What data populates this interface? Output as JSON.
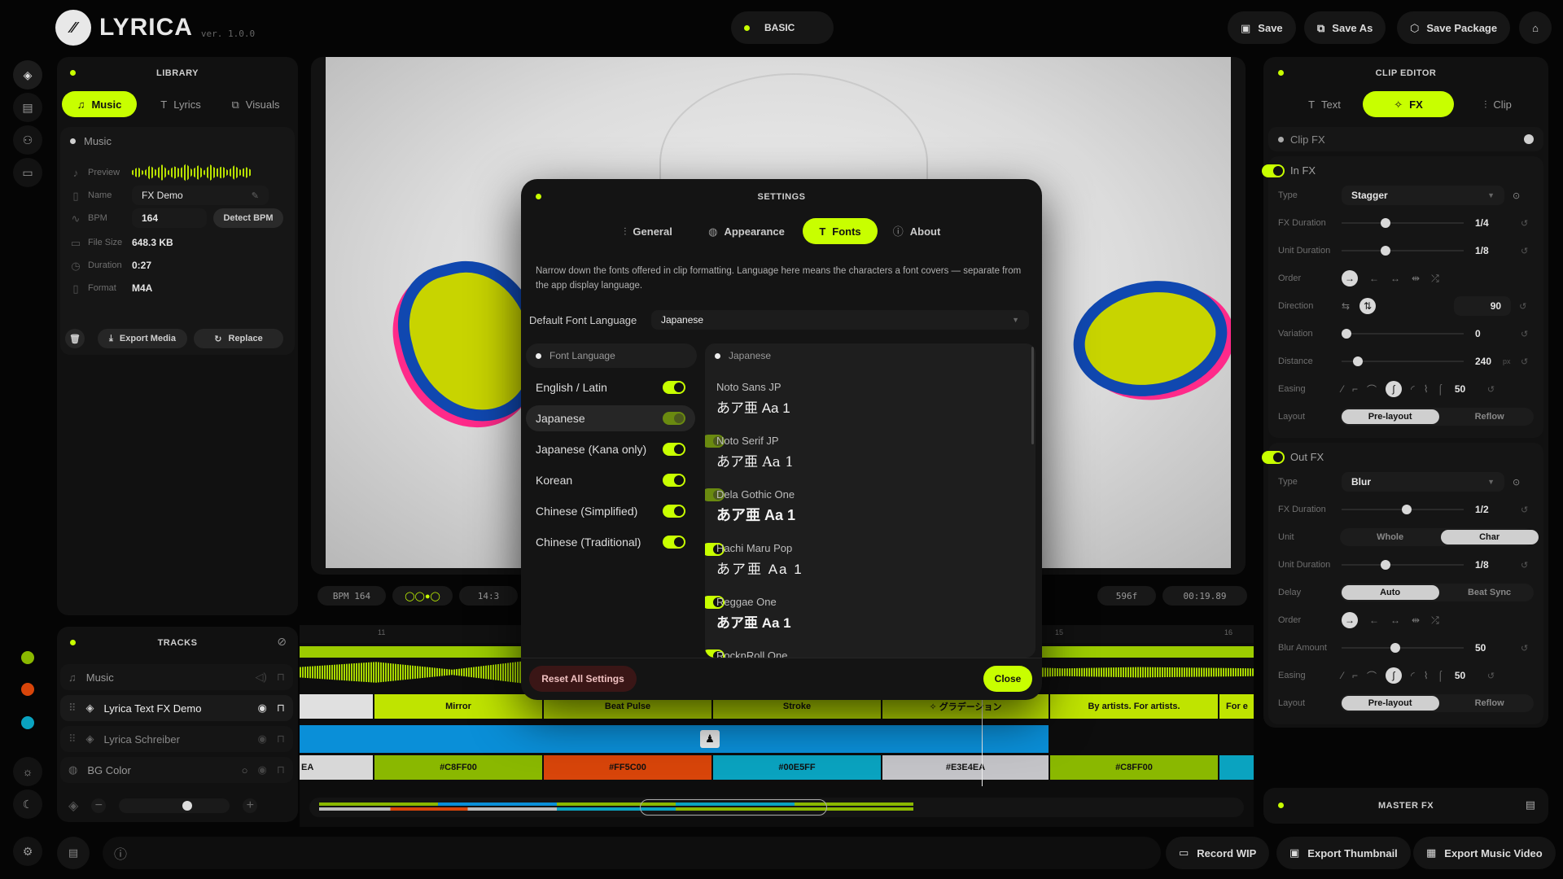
{
  "app": {
    "logo": "LYRICA",
    "version": "ver. 1.0.0",
    "mode": "BASIC"
  },
  "header": {
    "save": "Save",
    "save_as": "Save As",
    "save_package": "Save Package"
  },
  "library": {
    "title": "LIBRARY",
    "tabs": [
      "Music",
      "Lyrics",
      "Visuals"
    ],
    "section": "Music",
    "preview_label": "Preview",
    "name_label": "Name",
    "name_value": "FX Demo",
    "bpm_label": "BPM",
    "bpm_value": "164",
    "detect_bpm": "Detect BPM",
    "filesize_label": "File Size",
    "filesize_value": "648.3 KB",
    "duration_label": "Duration",
    "duration_value": "0:27",
    "format_label": "Format",
    "format_value": "M4A",
    "export_media": "Export Media",
    "replace": "Replace"
  },
  "preview": {
    "bpm": "BPM 164",
    "signature": "14:3",
    "frames": "596f",
    "time": "00:19.89"
  },
  "settings": {
    "title": "SETTINGS",
    "tabs": [
      "General",
      "Appearance",
      "Fonts",
      "About"
    ],
    "description": "Narrow down the fonts offered in clip formatting. Language here means the characters a font covers — separate from the app display language.",
    "default_lang_label": "Default Font Language",
    "default_lang_value": "Japanese",
    "lang_header": "Font Language",
    "languages": [
      "English / Latin",
      "Japanese",
      "Japanese (Kana only)",
      "Korean",
      "Chinese (Simplified)",
      "Chinese (Traditional)"
    ],
    "fonts_header": "Japanese",
    "fonts": [
      {
        "name": "Noto Sans JP",
        "sample": "あア亜 Aa 1"
      },
      {
        "name": "Noto Serif JP",
        "sample": "あア亜 Aa 1"
      },
      {
        "name": "Dela Gothic One",
        "sample": "あア亜 Aa 1"
      },
      {
        "name": "Hachi Maru Pop",
        "sample": "あア亜 Aa 1"
      },
      {
        "name": "Reggae One",
        "sample": "あア亜 Aa 1"
      },
      {
        "name": "RocknRoll One",
        "sample": ""
      }
    ],
    "reset": "Reset All Settings",
    "close": "Close"
  },
  "clip_editor": {
    "title": "CLIP EDITOR",
    "tabs": [
      "Text",
      "FX",
      "Clip"
    ],
    "clip_fx": "Clip FX",
    "in_fx": {
      "title": "In FX",
      "type_label": "Type",
      "type_value": "Stagger",
      "fx_duration_label": "FX Duration",
      "fx_duration_value": "1/4",
      "unit_duration_label": "Unit Duration",
      "unit_duration_value": "1/8",
      "order_label": "Order",
      "direction_label": "Direction",
      "direction_value": "90",
      "variation_label": "Variation",
      "variation_value": "0",
      "distance_label": "Distance",
      "distance_value": "240",
      "distance_unit": "px",
      "easing_label": "Easing",
      "easing_value": "50",
      "layout_label": "Layout",
      "layout_opts": [
        "Pre-layout",
        "Reflow"
      ]
    },
    "out_fx": {
      "title": "Out FX",
      "type_label": "Type",
      "type_value": "Blur",
      "fx_duration_label": "FX Duration",
      "fx_duration_value": "1/2",
      "unit_label": "Unit",
      "unit_opts": [
        "Whole",
        "Char"
      ],
      "unit_duration_label": "Unit Duration",
      "unit_duration_value": "1/8",
      "delay_label": "Delay",
      "delay_opts": [
        "Auto",
        "Beat Sync"
      ],
      "order_label": "Order",
      "blur_label": "Blur Amount",
      "blur_value": "50",
      "easing_label": "Easing",
      "easing_value": "50",
      "layout_label": "Layout",
      "layout_opts": [
        "Pre-layout",
        "Reflow"
      ]
    },
    "master_fx": "MASTER FX"
  },
  "tracks": {
    "title": "TRACKS",
    "items": [
      "Music",
      "Lyrica Text FX Demo",
      "Lyrica Schreiber",
      "BG Color"
    ]
  },
  "timeline": {
    "markers": [
      "11",
      "15",
      "16"
    ],
    "text_clips": [
      "Mirror",
      "Beat Pulse",
      "Stroke",
      "✧ グラデーション",
      "By artists. For artists.",
      "For e"
    ],
    "color_clips": [
      "EA",
      "#C8FF00",
      "#FF5C00",
      "#00E5FF",
      "#E3E4EA",
      "#C8FF00"
    ]
  },
  "footer": {
    "record": "Record WIP",
    "thumbnail": "Export Thumbnail",
    "export_video": "Export Music Video"
  },
  "colors": {
    "accent": "#C8FF00",
    "orange": "#FF5C00",
    "cyan": "#00E5FF",
    "blue": "#0A8FD8",
    "gray": "#E3E4EA"
  }
}
